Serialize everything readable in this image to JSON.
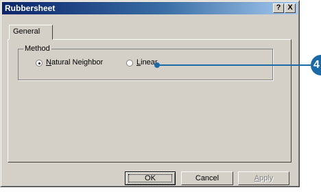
{
  "window": {
    "title": "Rubbersheet",
    "help_glyph": "?",
    "close_glyph": "X"
  },
  "tabs": [
    {
      "label": "General",
      "active": true
    }
  ],
  "method_group": {
    "legend": "Method",
    "options": [
      {
        "label": "Natural Neighbor",
        "mnemonic": "N",
        "rest": "atural Neighbor",
        "selected": true
      },
      {
        "label": "Linear",
        "mnemonic": "L",
        "rest": "inear",
        "selected": false
      }
    ]
  },
  "buttons": {
    "ok": "OK",
    "cancel": "Cancel",
    "apply": {
      "mnemonic": "A",
      "rest": "pply",
      "enabled": false
    }
  },
  "callout": {
    "number": "4",
    "color": "#1a6aa8"
  }
}
